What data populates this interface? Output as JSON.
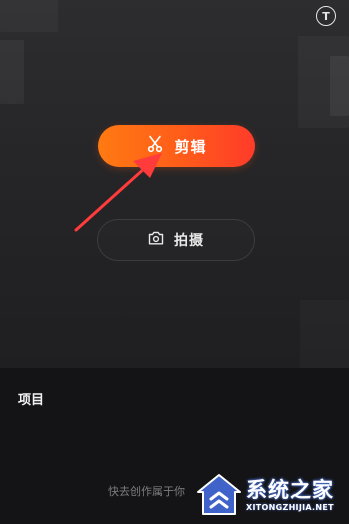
{
  "header": {
    "top_right_icon": "T"
  },
  "actions": {
    "cut_label": "剪辑",
    "cut_icon": "scissors-icon",
    "shoot_label": "拍摄",
    "shoot_icon": "camera-icon"
  },
  "projects": {
    "title": "项目",
    "empty_text": "快去创作属于你"
  },
  "watermark": {
    "cn": "系统之家",
    "en": "XITONGZHIJIA.NET"
  },
  "colors": {
    "accent_start": "#ff7a12",
    "accent_end": "#ff3b2a",
    "arrow": "#ff3b3b",
    "background": "#262628"
  }
}
